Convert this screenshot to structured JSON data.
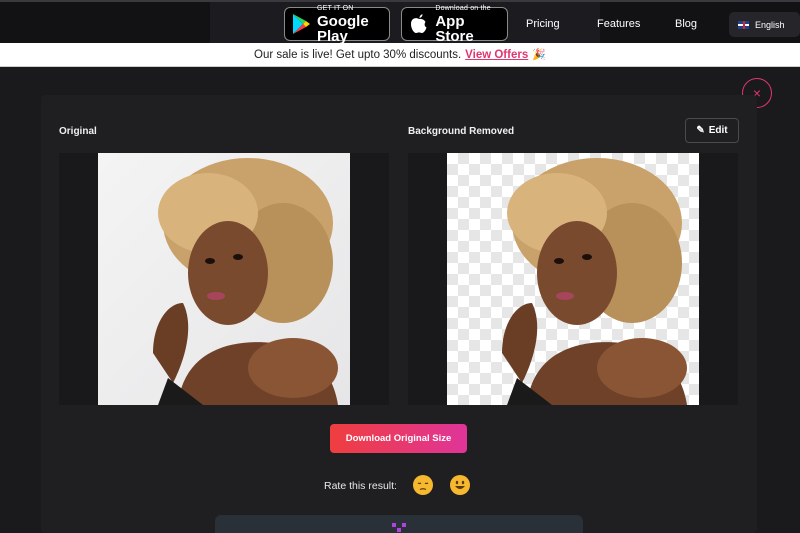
{
  "nav": {
    "google_play": {
      "small": "GET IT ON",
      "big": "Google Play"
    },
    "app_store": {
      "small": "Download on the",
      "big": "App Store"
    },
    "links": [
      "Pricing",
      "Features",
      "Blog"
    ],
    "language": "English"
  },
  "promo": {
    "text": "Our sale is live! Get upto 30% discounts.",
    "link": "View Offers",
    "emoji": "🎉"
  },
  "modal": {
    "close_symbol": "×",
    "original_label": "Original",
    "removed_label": "Background Removed",
    "edit_label": "Edit",
    "download_label": "Download Original Size",
    "rate_label": "Rate this result:",
    "rate_bad": "😔",
    "rate_good": "😀"
  },
  "colors": {
    "accent": "#e0366f",
    "download_start": "#ef3e3e",
    "download_end": "#e0349a"
  }
}
